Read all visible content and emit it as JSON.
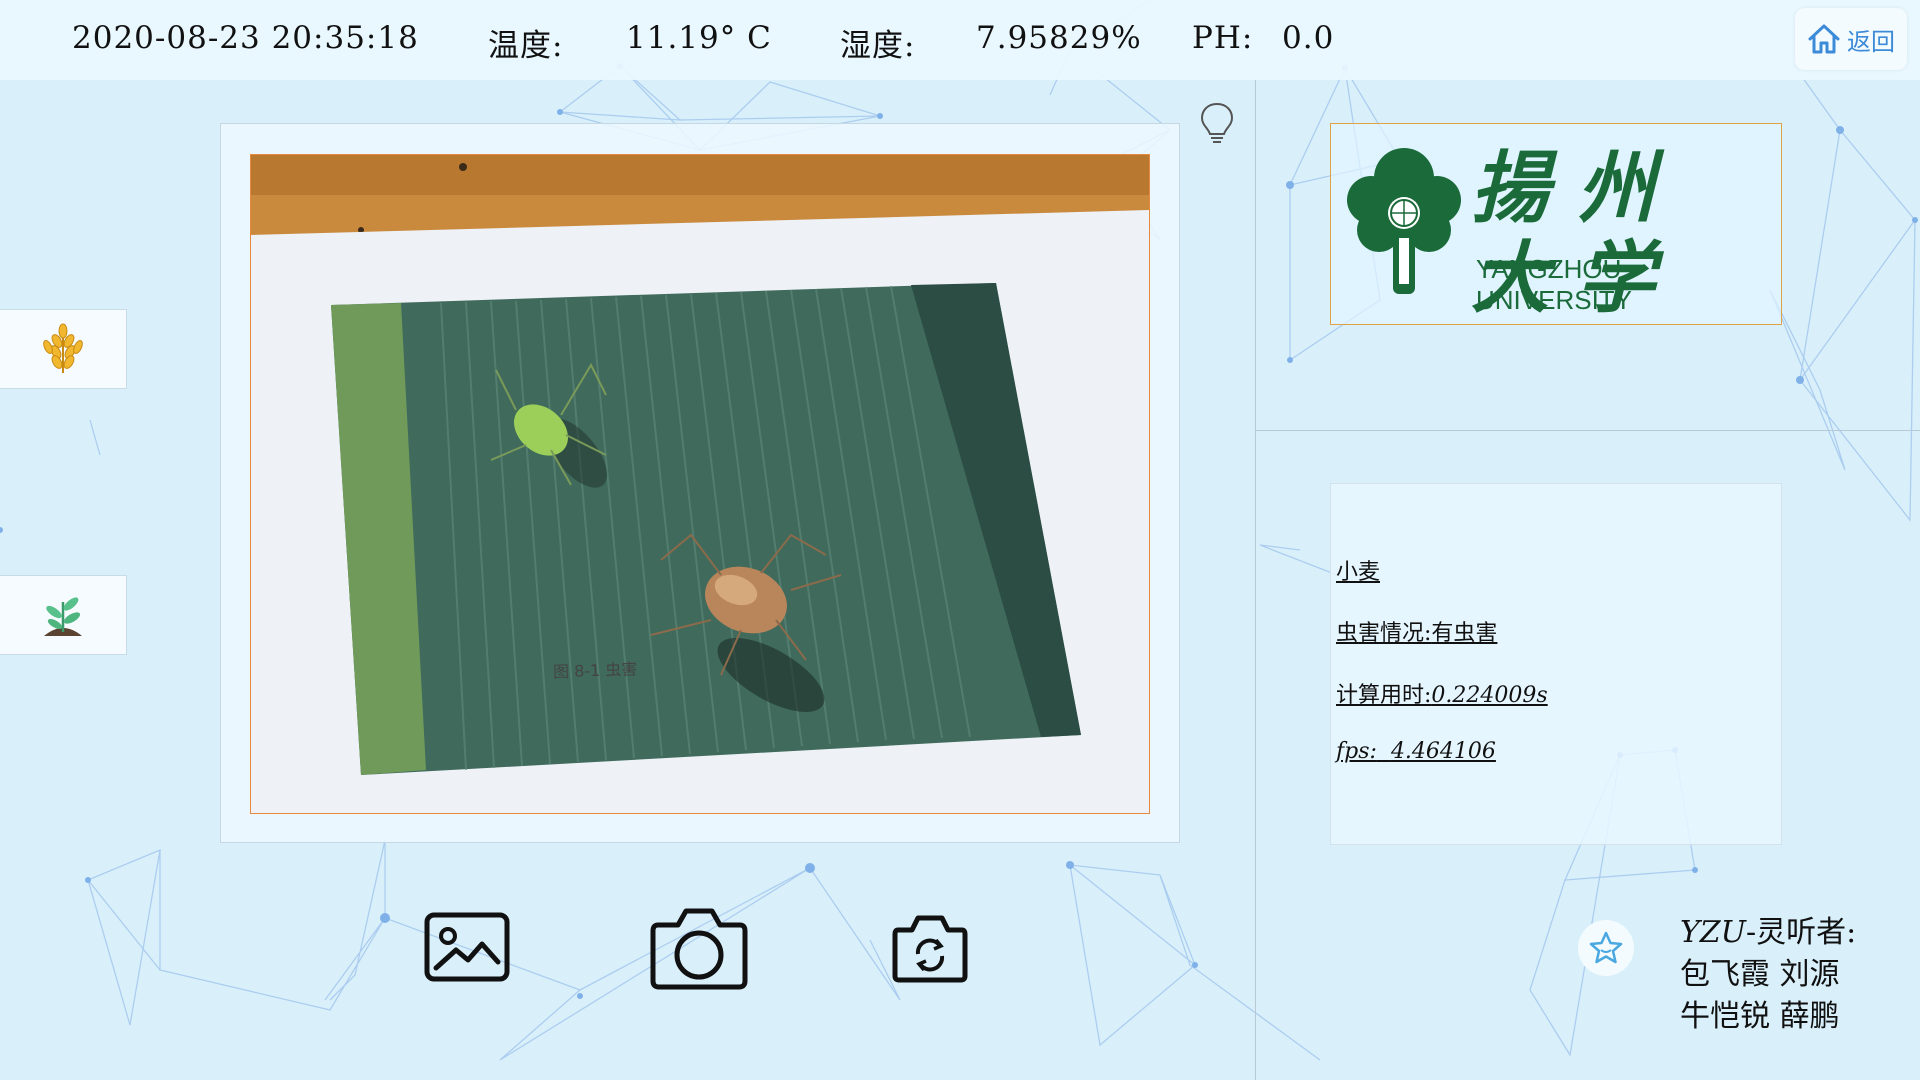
{
  "status": {
    "datetime": "2020-08-23 20:35:18",
    "temp_label": "温度:",
    "temp_value": "11.19° C",
    "humidity_label": "湿度:",
    "humidity_value": "7.95829%",
    "ph_label": "PH:",
    "ph_value": "0.0"
  },
  "header": {
    "back_label": "返回"
  },
  "photo": {
    "caption": "图 8-1 虫害"
  },
  "logo": {
    "name_cn": "揚州大学",
    "name_en": "YANGZHOU UNIVERSITY"
  },
  "result": {
    "crop": "小麦",
    "pest_label": "虫害情况:",
    "pest_value": "有虫害",
    "time_label": "计算用时:",
    "time_value": "0.224009s",
    "fps_label": "fps:",
    "fps_value": "4.464106"
  },
  "credits": {
    "brand": "YZU",
    "team_label": "灵听者:",
    "line2": "包飞霞 刘源",
    "line3": "牛恺锐 薛鹏"
  },
  "icons": {
    "back": "home-icon",
    "bulb": "lightbulb-icon",
    "wheat": "wheat-icon",
    "seedling": "seedling-icon",
    "gallery": "image-icon",
    "camera": "camera-icon",
    "switch_camera": "switch-camera-icon",
    "star": "star-icon"
  },
  "colors": {
    "background": "#d9f0fb",
    "accent_blue": "#3d8bd8",
    "frame_orange": "#e58a3c",
    "logo_green": "#1b6a3a"
  }
}
